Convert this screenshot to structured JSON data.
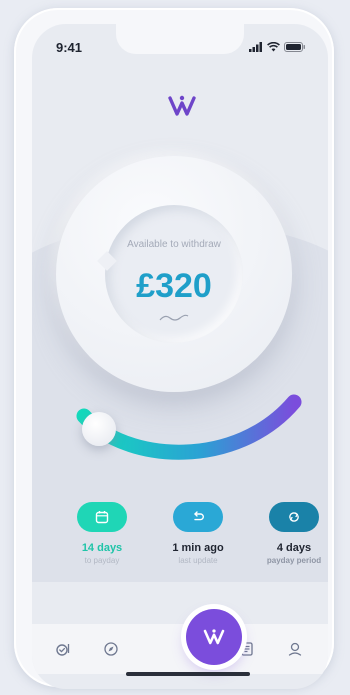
{
  "status_bar": {
    "time": "9:41",
    "icons": [
      "signal-icon",
      "wifi-icon",
      "battery-icon"
    ]
  },
  "brand": {
    "logo": "w-logo-icon"
  },
  "balance": {
    "label": "Available to withdraw",
    "amount": "£320"
  },
  "stats": [
    {
      "icon": "calendar-icon",
      "value": "14 days",
      "caption": "to payday",
      "color": "#1fd6b6"
    },
    {
      "icon": "undo-icon",
      "value": "1 min ago",
      "caption": "last update",
      "color": "#2aa8d6"
    },
    {
      "icon": "refresh-icon",
      "value": "4 days",
      "caption": "payday period",
      "color": "#1a82a8"
    }
  ],
  "tab_bar": {
    "items": [
      "checklist-icon",
      "compass-icon",
      "w-logo-icon",
      "document-icon",
      "profile-icon"
    ],
    "active": "w-logo-icon"
  },
  "colors": {
    "accent_purple": "#7b4ddc",
    "teal": "#1fd6b6",
    "blue": "#1f9fc9"
  }
}
